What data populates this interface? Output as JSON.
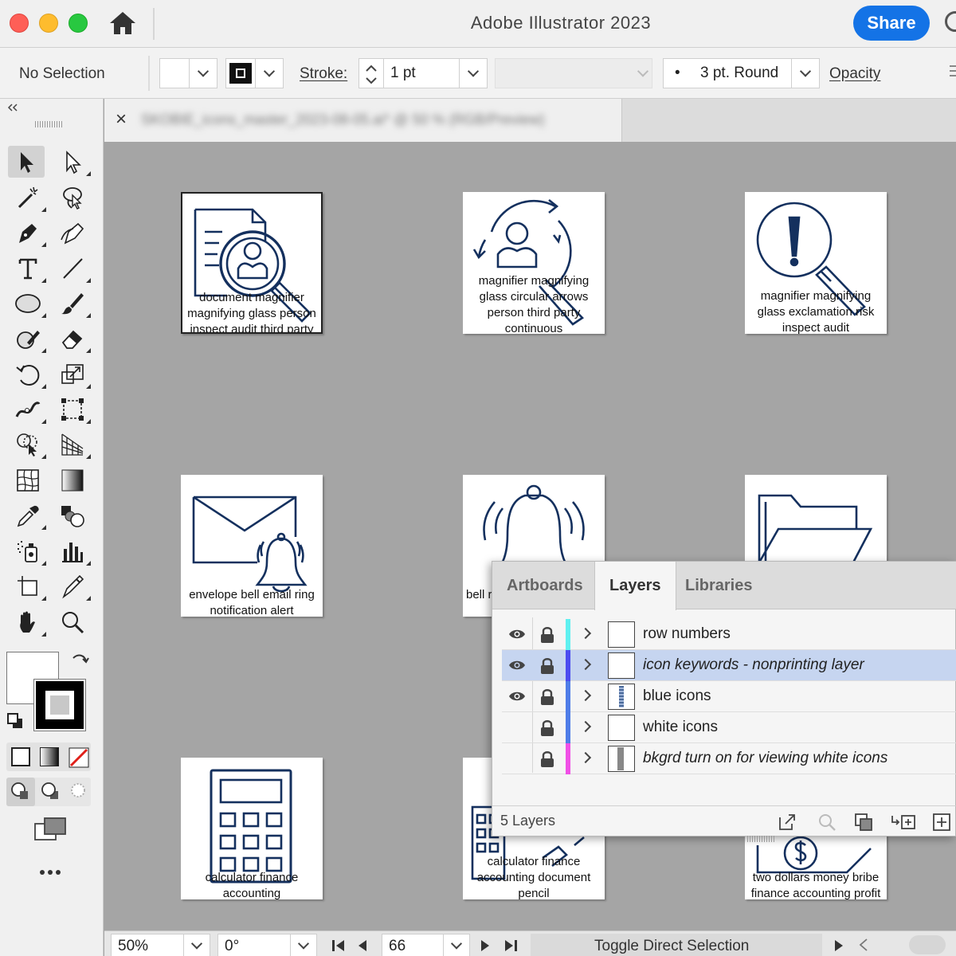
{
  "app": {
    "title": "Adobe Illustrator 2023",
    "share_label": "Share"
  },
  "control_bar": {
    "selection_label": "No Selection",
    "stroke_label": "Stroke:",
    "stroke_value": "1 pt",
    "brush_value": "3 pt. Round",
    "brush_dot": "•",
    "opacity_label": "Opacity"
  },
  "document_tab": {
    "close_glyph": "×",
    "title": "SKOBIE_icons_master_2023-08-05.ai* @ 50 % (RGB/Preview)"
  },
  "artboards": [
    {
      "label": "document magnifier magnifying glass person inspect audit third party",
      "icon": "document-magnifier-person-icon"
    },
    {
      "label": "magnifier magnifying glass circular arrows person third party continuous",
      "icon": "magnifier-circular-arrows-person-icon"
    },
    {
      "label": "magnifier magnifying glass exclamation risk inspect audit",
      "icon": "magnifier-exclamation-icon"
    },
    {
      "label": "envelope bell email ring notification alert",
      "icon": "envelope-bell-icon"
    },
    {
      "label": "bell r",
      "icon": "bell-ringing-icon"
    },
    {
      "label": "",
      "icon": "folder-open-icon"
    },
    {
      "label": "calculator finance accounting",
      "icon": "calculator-icon"
    },
    {
      "label": "calculator finance accounting document pencil",
      "icon": "calculator-document-pencil-icon"
    },
    {
      "label": "two dollars money bribe finance accounting profit",
      "icon": "dollar-coin-hand-icon"
    }
  ],
  "layers_panel": {
    "tabs": [
      {
        "label": "Artboards",
        "active": false
      },
      {
        "label": "Layers",
        "active": true
      },
      {
        "label": "Libraries",
        "active": false
      }
    ],
    "layers": [
      {
        "name": "row numbers",
        "visible": true,
        "color": "#5ff0f0",
        "italic": false,
        "highlighted": false
      },
      {
        "name": "icon keywords - nonprinting layer",
        "visible": true,
        "color": "#4b4bf0",
        "italic": true,
        "highlighted": true
      },
      {
        "name": "blue icons",
        "visible": true,
        "color": "#4f7de8",
        "italic": false,
        "highlighted": false
      },
      {
        "name": "white icons",
        "visible": false,
        "color": "#4f7de8",
        "italic": false,
        "highlighted": false
      },
      {
        "name": "bkgrd turn on for viewing white icons",
        "visible": false,
        "color": "#f050e6",
        "italic": true,
        "highlighted": false
      }
    ],
    "count_label": "5 Layers"
  },
  "status_bar": {
    "zoom": "50%",
    "rotation": "0°",
    "artboard_number": "66",
    "tool_status": "Toggle Direct Selection"
  },
  "colors": {
    "icon_navy": "#14305e",
    "accent_blue": "#1473e6"
  }
}
